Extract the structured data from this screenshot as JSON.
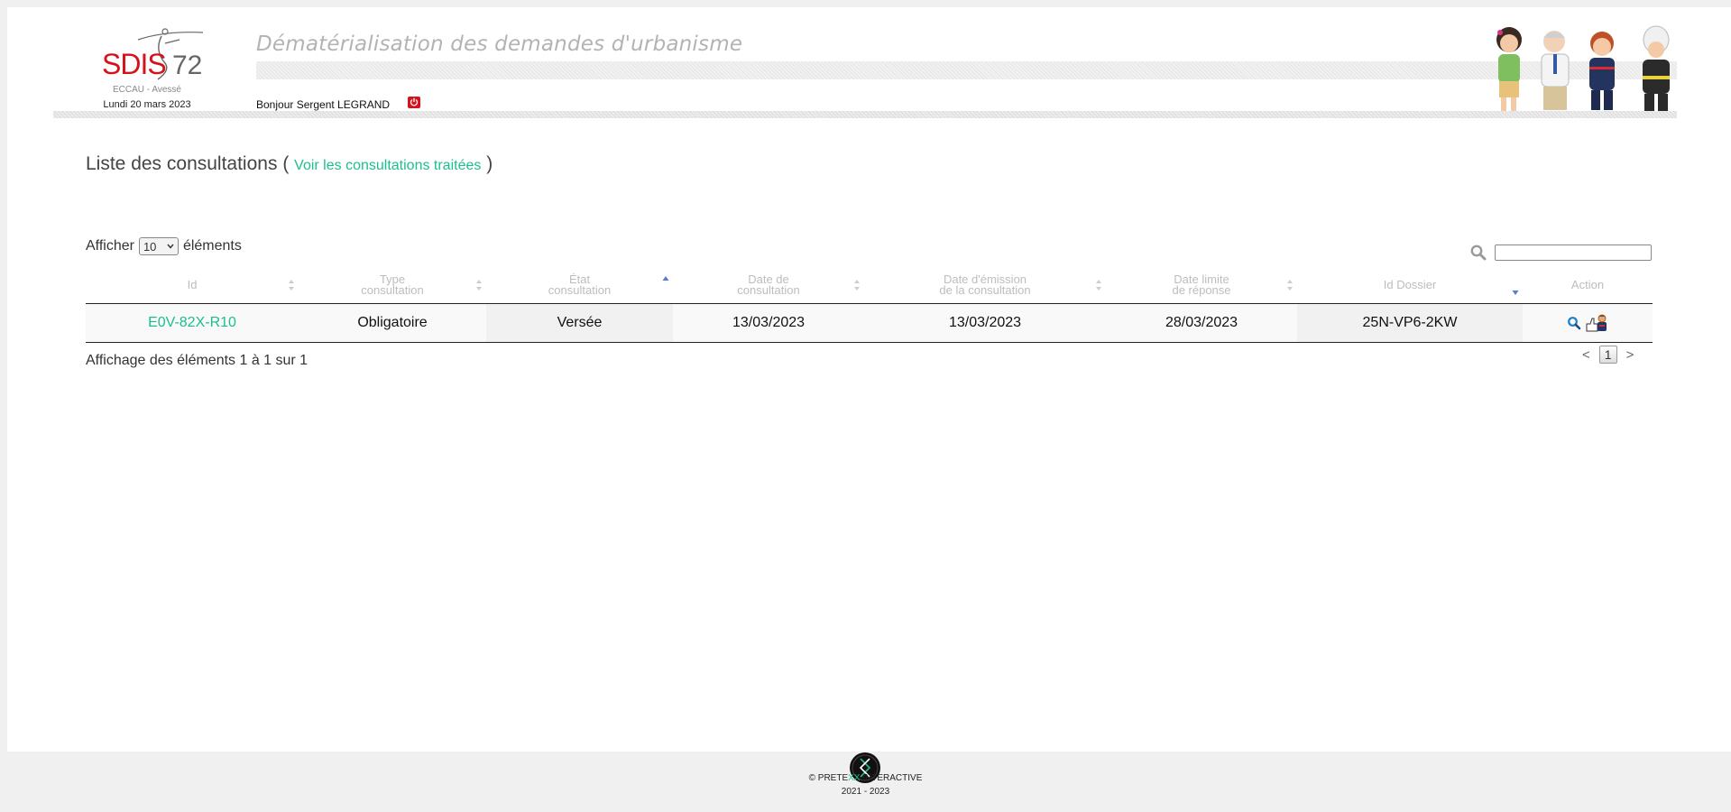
{
  "header": {
    "logo_text": "SDIS 72",
    "logo_subtitle": "ECCAU - Avessé",
    "date": "Lundi 20 mars 2023",
    "app_title": "Dématérialisation des demandes d'urbanisme",
    "greeting": "Bonjour Sergent LEGRAND",
    "logout_icon": "power-icon",
    "brand_color": "#d4141c"
  },
  "main": {
    "title": "Liste des consultations",
    "paren_open": "(",
    "link_label": "Voir les consultations traitées",
    "paren_close": ")",
    "length_prefix": "Afficher",
    "length_value": "10",
    "length_suffix": "éléments",
    "search_value": "",
    "accent_color": "#1bbf8f",
    "table": {
      "columns": [
        {
          "line1": "Id",
          "line2": "",
          "sort": "both"
        },
        {
          "line1": "Type",
          "line2": "consultation",
          "sort": "both"
        },
        {
          "line1": "État",
          "line2": "consultation",
          "sort": "asc"
        },
        {
          "line1": "Date de",
          "line2": "consultation",
          "sort": "both"
        },
        {
          "line1": "Date d'émission",
          "line2": "de la consultation",
          "sort": "both"
        },
        {
          "line1": "Date limite",
          "line2": "de réponse",
          "sort": "both"
        },
        {
          "line1": "Id Dossier",
          "line2": "",
          "sort": "desc"
        },
        {
          "line1": "Action",
          "line2": "",
          "sort": "none"
        }
      ],
      "rows": [
        {
          "id": "E0V-82X-R10",
          "type": "Obligatoire",
          "etat": "Versée",
          "date_consultation": "13/03/2023",
          "date_emission": "13/03/2023",
          "date_limite": "28/03/2023",
          "id_dossier": "25N-VP6-2KW",
          "actions": [
            "magnifier-icon",
            "respond-icon"
          ]
        }
      ]
    },
    "info": "Affichage des éléments 1 à 1 sur 1",
    "pager": {
      "prev": "<",
      "current": "1",
      "next": ">"
    }
  },
  "footer": {
    "copy_prefix": "© PRETE",
    "copy_xx": "XX",
    "copy_suffix": " INTERACTIVE",
    "years": "2021 - 2023"
  }
}
